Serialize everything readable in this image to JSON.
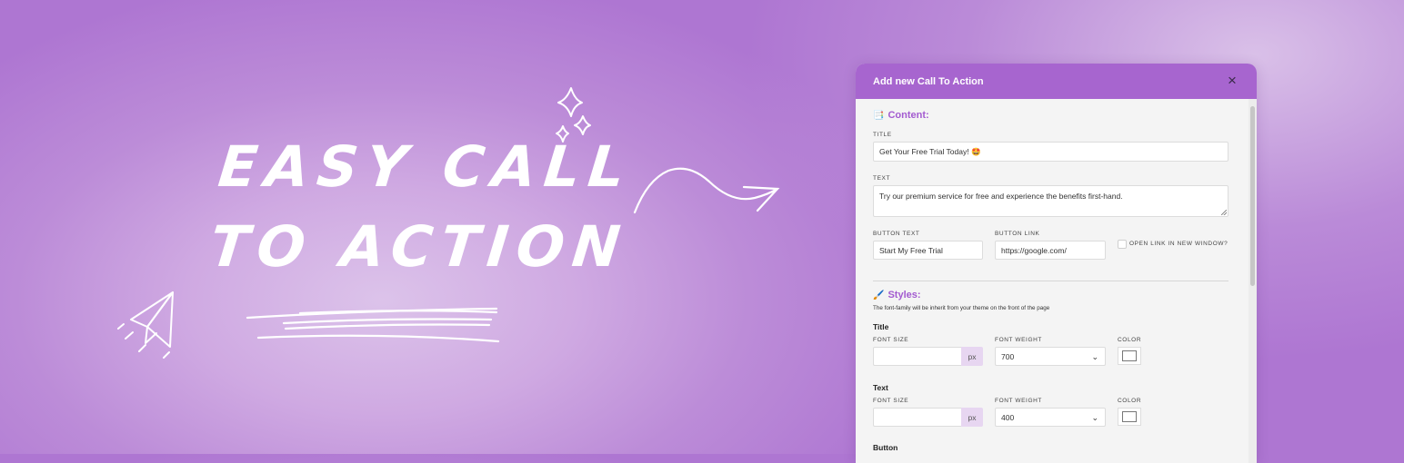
{
  "hero": {
    "line1": "EASY CALL",
    "line2": "TO ACTION"
  },
  "modal": {
    "title": "Add new Call To Action",
    "close_icon": "×",
    "content": {
      "heading": "Content:",
      "heading_icon": "📑",
      "title_label": "TITLE",
      "title_value": "Get Your Free Trial Today! 🤩",
      "text_label": "TEXT",
      "text_value": "Try our premium service for free and experience the benefits first-hand.",
      "button_text_label": "BUTTON TEXT",
      "button_text_value": "Start My Free Trial",
      "button_link_label": "BUTTON LINK",
      "button_link_value": "https://google.com/",
      "new_window_label": "OPEN LINK IN NEW WINDOW?"
    },
    "styles": {
      "heading": "Styles:",
      "heading_icon": "🖌️",
      "note": "The font-family will be inherit from your theme on the front of the page",
      "title_group": {
        "heading": "Title",
        "font_size_label": "FONT SIZE",
        "font_size_value": "",
        "unit": "px",
        "font_weight_label": "FONT WEIGHT",
        "font_weight_value": "700",
        "color_label": "COLOR"
      },
      "text_group": {
        "heading": "Text",
        "font_size_label": "FONT SIZE",
        "font_size_value": "",
        "unit": "px",
        "font_weight_label": "FONT WEIGHT",
        "font_weight_value": "400",
        "color_label": "COLOR"
      },
      "button_group": {
        "heading": "Button"
      }
    }
  },
  "colors": {
    "accent": "#a765cf",
    "heading": "#a35bd0",
    "addon": "#e7d6f1"
  },
  "icons": [
    "close-icon",
    "select-caret-icon",
    "paper-plane-icon",
    "sparkle-icon",
    "arrow-icon"
  ]
}
